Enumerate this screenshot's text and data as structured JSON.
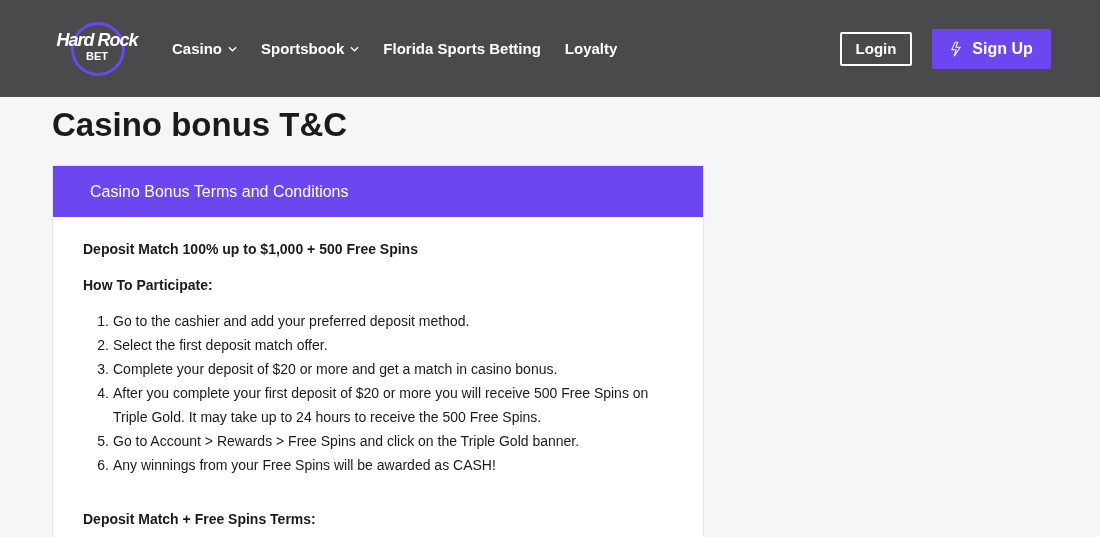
{
  "header": {
    "logo": {
      "line_1": "Hard Rock",
      "line_2": "BET"
    },
    "nav": [
      {
        "label": "Casino",
        "dropdown": true
      },
      {
        "label": "Sportsbook",
        "dropdown": true
      },
      {
        "label": "Florida Sports Betting",
        "dropdown": false
      },
      {
        "label": "Loyalty",
        "dropdown": false
      }
    ],
    "login_button": "Login",
    "signup_button": "Sign Up"
  },
  "page_title": "Casino bonus T&C",
  "panel": {
    "title": "Casino Bonus Terms and Conditions",
    "offer": "Deposit Match 100% up to $1,000 + 500 Free Spins",
    "steps_heading": "How To Participate:",
    "steps": [
      {
        "number": "1.",
        "text": "Go to the cashier and add your preferred deposit method."
      },
      {
        "number": "2.",
        "text": "Select the first deposit match offer."
      },
      {
        "number": "3.",
        "text": "Complete your deposit of $20 or more and get a match in casino bonus."
      },
      {
        "number": "4.",
        "text": "After you complete your first deposit of $20 or more you will receive 500 Free Spins on Triple Gold. It may take up to 24 hours to receive the 500 Free Spins."
      },
      {
        "number": "5.",
        "text": "Go to Account > Rewards > Free Spins and click on the Triple Gold banner."
      },
      {
        "number": "6.",
        "text": "Any winnings from your Free Spins will be awarded as CASH!"
      }
    ],
    "terms_heading": "Deposit Match + Free Spins Terms:"
  }
}
